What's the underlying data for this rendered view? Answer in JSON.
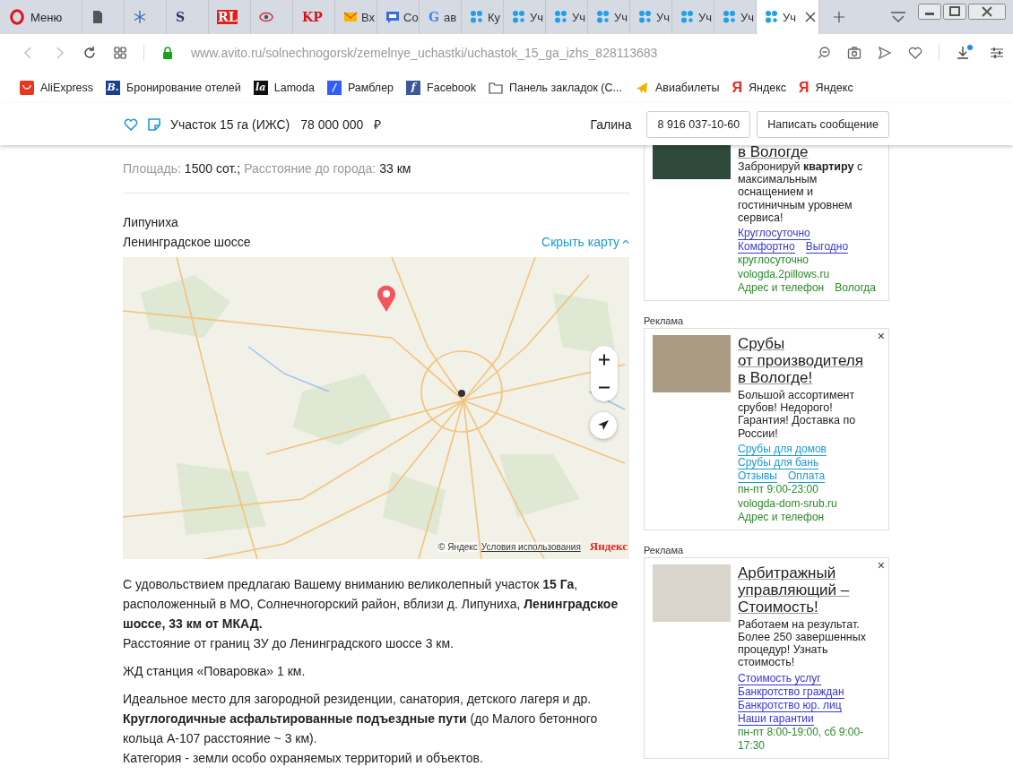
{
  "browser": {
    "menu_label": "Меню",
    "tabs": [
      {
        "kind": "page",
        "selected": false
      },
      {
        "kind": "snowflake",
        "selected": false
      },
      {
        "kind": "logo",
        "logo": "S",
        "color": "#2b3a67",
        "selected": false
      },
      {
        "kind": "logo",
        "logo": "RL",
        "color": "#e0201b",
        "filled": true,
        "selected": false
      },
      {
        "kind": "eye",
        "selected": false
      },
      {
        "kind": "logo",
        "logo": "KP",
        "color": "#d4151b",
        "selected": false
      },
      {
        "kind": "mail",
        "label": "Вх",
        "selected": false
      },
      {
        "kind": "chat",
        "label": "Со",
        "selected": false
      },
      {
        "kind": "logo",
        "logo": "G",
        "color": "#4285f4",
        "label": "ав",
        "selected": false
      },
      {
        "kind": "paw",
        "label": "Ку",
        "selected": false
      },
      {
        "kind": "paw",
        "label": "Уч",
        "selected": false
      },
      {
        "kind": "paw",
        "label": "Уч",
        "selected": false
      },
      {
        "kind": "paw",
        "label": "Уч",
        "selected": false
      },
      {
        "kind": "paw",
        "label": "Уч",
        "selected": false
      },
      {
        "kind": "paw",
        "label": "Уч",
        "selected": false
      },
      {
        "kind": "paw",
        "label": "Уч",
        "selected": false
      },
      {
        "kind": "paw",
        "label": "Уч",
        "selected": true
      }
    ],
    "url": "www.avito.ru/solnechnogorsk/zemelnye_uchastki/uchastok_15_ga_izhs_828113683",
    "bookmarks": [
      {
        "kind": "bag",
        "label": "AliExpress",
        "color": "#e8371f"
      },
      {
        "kind": "badge",
        "badge": "B.",
        "label": "Бронирование отелей",
        "color": "#1b3f8f"
      },
      {
        "kind": "badge",
        "badge": "la",
        "label": "Lamoda",
        "color": "#111111"
      },
      {
        "kind": "badge",
        "badge": "/",
        "label": "Рамблер",
        "color": "#315efb"
      },
      {
        "kind": "badge",
        "badge": "f",
        "label": "Facebook",
        "color": "#3b5998"
      },
      {
        "kind": "folder",
        "label": "Панель закладок (С..."
      },
      {
        "kind": "plane",
        "label": "Авиабилеты",
        "color": "#f0b400"
      },
      {
        "kind": "letter",
        "badge": "Я",
        "label": "Яндекс",
        "color": "#f0251b"
      },
      {
        "kind": "letter",
        "badge": "Я",
        "label": "Яндекс",
        "color": "#f0251b"
      }
    ]
  },
  "header": {
    "title": "Участок 15 га (ИЖС)",
    "price": "78 000 000",
    "currency": "₽",
    "seller": "Галина",
    "phone": "8 916 037-10-60",
    "message_button": "Написать сообщение"
  },
  "params": [
    {
      "label": "Площадь:",
      "value": "1500 сот.;"
    },
    {
      "label": "Расстояние до города:",
      "value": "33 км"
    }
  ],
  "location": {
    "place": "Липуниха",
    "road": "Ленинградское шоссе",
    "map_toggle": "Скрыть карту"
  },
  "map": {
    "copyright": "© Яндекс",
    "terms_link": "Условия использования",
    "logo": "Яндекс"
  },
  "description": [
    [
      "С удовольствием предлагаю Вашему вниманию великолепный участок **15 Га**, расположенный в МО, Солнечногорский район, вблизи д. Липуниха, **Ленинградское шоссе, 33 км от МКАД.**",
      "Расстояние от границ ЗУ до Ленинградского шоссе 3 км."
    ],
    [
      "ЖД станция «Поваровка» 1 км."
    ],
    [
      "Идеальное место для загородной резиденции, санатория, детского лагеря и др.",
      "**Круглогодичные асфальтированные подъездные пути** (до Малого бетонного кольца А-107 расстояние ~ 3 км).",
      "Категория - земли особо охраняемых территорий и объектов."
    ]
  ],
  "ads": [
    {
      "title": "в Вологде",
      "text": "Забронируй **квартиру** с максимальным оснащением и гостиничным уровнем сервиса!",
      "color": "#3a3acc",
      "link_rows": [
        [
          "Круглосуточно"
        ],
        [
          "Комфортно",
          "Выгодно"
        ]
      ],
      "hours": "круглосуточно",
      "domain": "vologda.2pillows.ru",
      "contacts": [
        "Адрес и телефон",
        "Вологда"
      ]
    },
    {
      "label": "Реклама",
      "close": "×",
      "title": "Срубы\nот производителя\nв Вологде!",
      "text": "Большой ассортимент срубов! Недорого! Гарантия! Доставка по России!",
      "color": "#1a9ad6",
      "link_rows": [
        [
          "Срубы для домов"
        ],
        [
          "Срубы для бань"
        ],
        [
          "Отзывы",
          "Оплата"
        ]
      ],
      "hours": "пн-пт 9:00-23:00",
      "domain": "vologda-dom-srub.ru",
      "contacts": [
        "Адрес и телефон"
      ]
    },
    {
      "label": "Реклама",
      "close": "×",
      "title": "Арбитражный\nуправляющий –\nСтоимость!",
      "text": "Работаем на результат. Более 250 завершенных процедур! Узнать стоимость!",
      "color": "#3535d8",
      "link_rows": [
        [
          "Стоимость услуг"
        ],
        [
          "Банкротство граждан"
        ],
        [
          "Банкротство юр. лиц"
        ],
        [
          "Наши гарантии"
        ]
      ],
      "hours": "пн-пт 8:00-19:00, сб 9:00-17:30"
    }
  ]
}
